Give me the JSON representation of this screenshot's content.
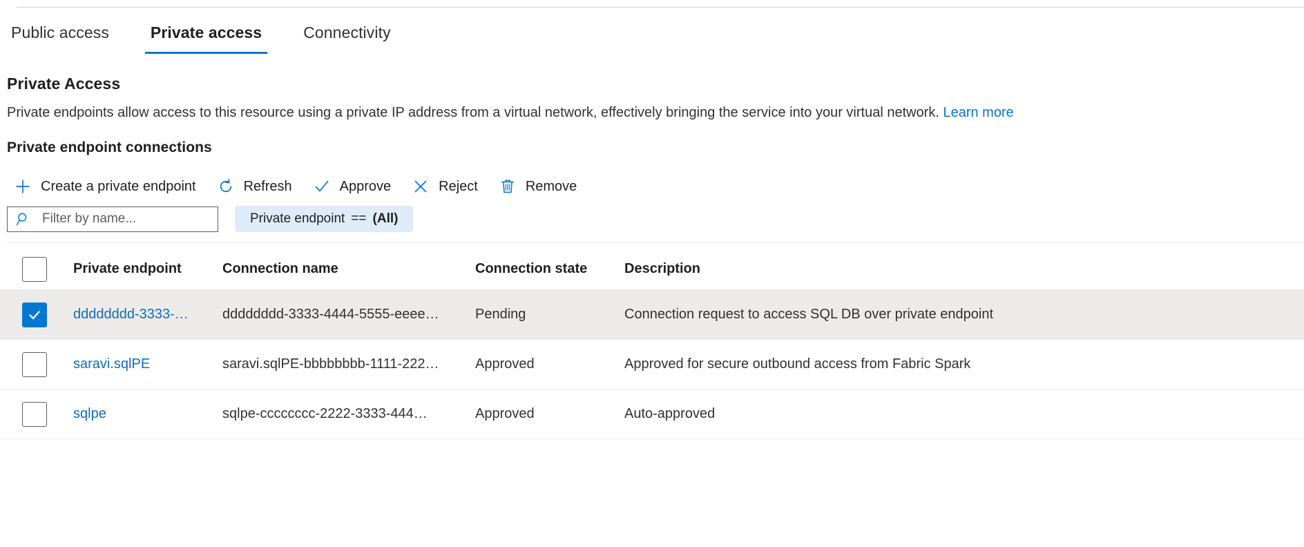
{
  "tabs": [
    {
      "label": "Public access",
      "active": false
    },
    {
      "label": "Private access",
      "active": true
    },
    {
      "label": "Connectivity",
      "active": false
    }
  ],
  "section": {
    "title": "Private Access",
    "description": "Private endpoints allow access to this resource using a private IP address from a virtual network, effectively bringing the service into your virtual network.",
    "learn_more": "Learn more",
    "subsection_title": "Private endpoint connections"
  },
  "commands": [
    {
      "label": "Create a private endpoint",
      "icon": "plus-icon"
    },
    {
      "label": "Refresh",
      "icon": "refresh-icon"
    },
    {
      "label": "Approve",
      "icon": "checkmark-icon"
    },
    {
      "label": "Reject",
      "icon": "cross-icon"
    },
    {
      "label": "Remove",
      "icon": "trash-icon"
    }
  ],
  "filter": {
    "search_placeholder": "Filter by name...",
    "search_value": "",
    "search_icon": "search-icon",
    "pill_field": "Private endpoint",
    "pill_operator": "==",
    "pill_value": "(All)"
  },
  "table": {
    "columns": [
      "Private endpoint",
      "Connection name",
      "Connection state",
      "Description"
    ],
    "select_all_checked": false,
    "rows": [
      {
        "selected": true,
        "endpoint": "dddddddd-3333-…",
        "connection_name": "dddddddd-3333-4444-5555-eeee…",
        "state": "Pending",
        "description": "Connection request to access SQL DB over private endpoint"
      },
      {
        "selected": false,
        "endpoint": "saravi.sqlPE",
        "connection_name": "saravi.sqlPE-bbbbbbbb-1111-222…",
        "state": "Approved",
        "description": "Approved for secure outbound access from Fabric Spark"
      },
      {
        "selected": false,
        "endpoint": "sqlpe",
        "connection_name": "sqlpe-cccccccc-2222-3333-444…",
        "state": "Approved",
        "description": "Auto-approved"
      }
    ]
  },
  "colors": {
    "accent": "#0078d4",
    "link": "#0f6cbd",
    "selected_row": "#edebe9",
    "pill_background": "#deecf9"
  }
}
